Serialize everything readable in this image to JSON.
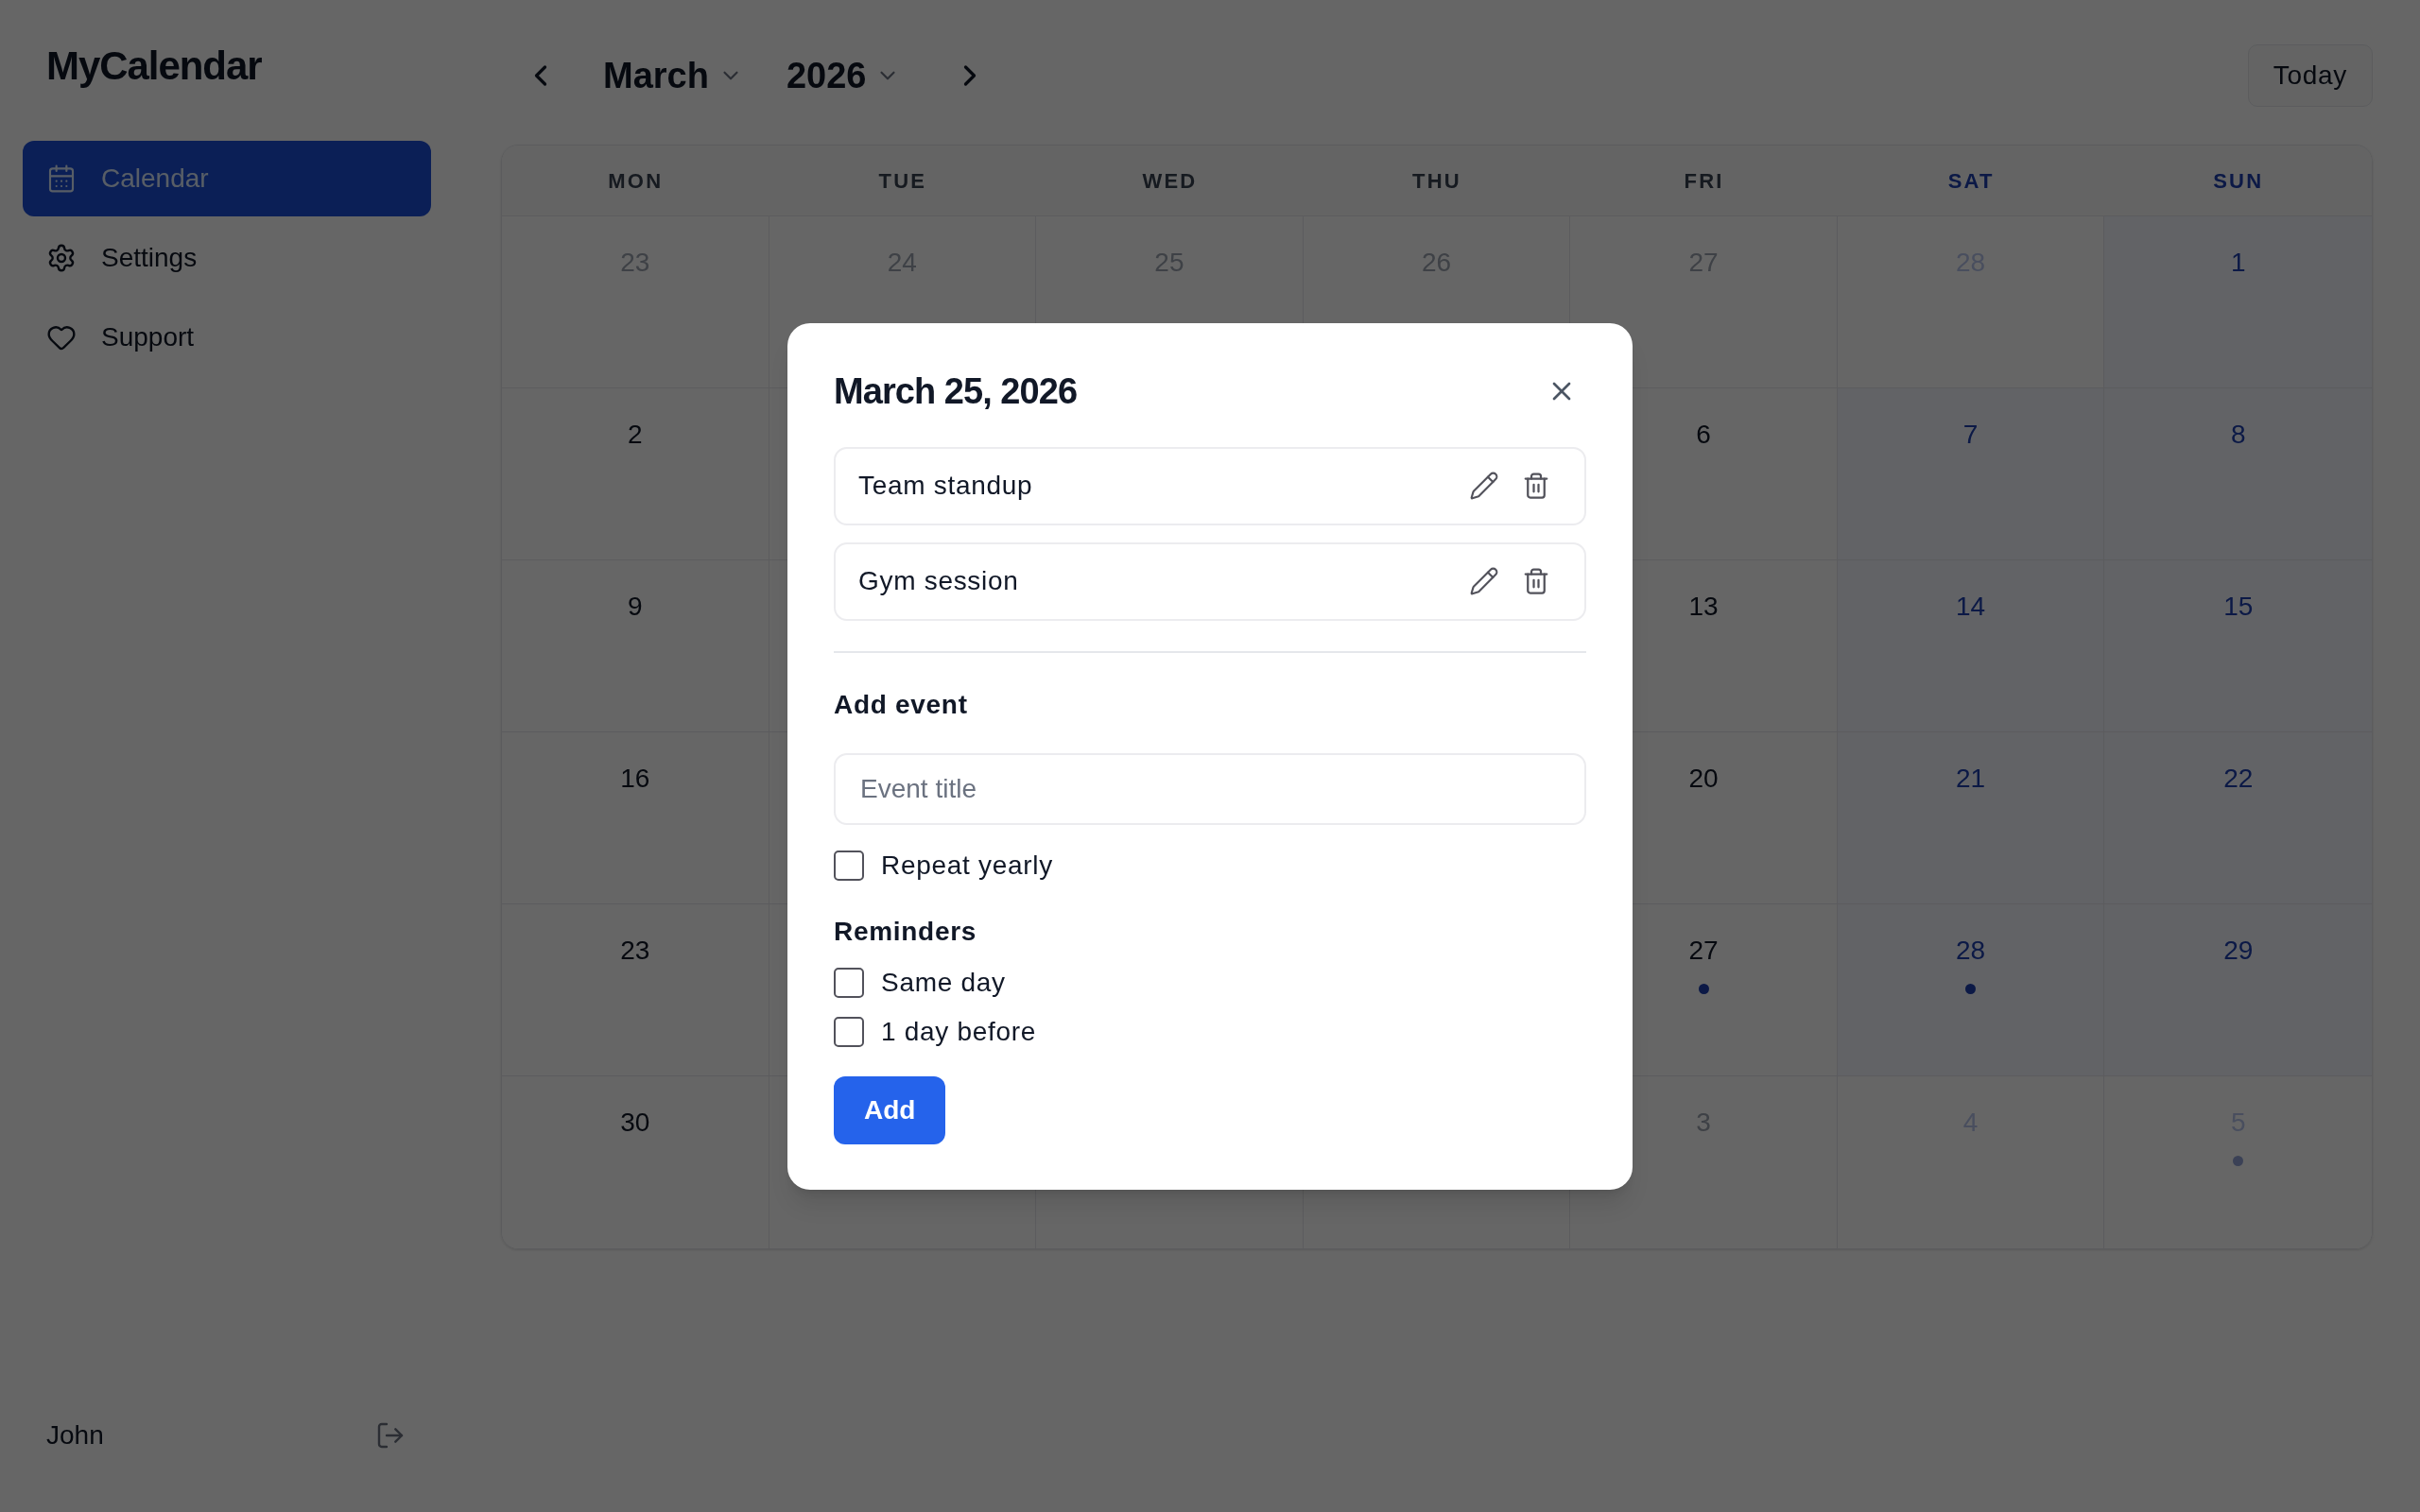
{
  "sidebar": {
    "brand": "MyCalendar",
    "nav": [
      {
        "label": "Calendar",
        "selected": true
      },
      {
        "label": "Settings",
        "selected": false
      },
      {
        "label": "Support",
        "selected": false
      }
    ],
    "user": {
      "name": "John"
    }
  },
  "header": {
    "month": "March",
    "year": "2026",
    "today_button": "Today"
  },
  "calendar": {
    "weekdays": [
      "MON",
      "TUE",
      "WED",
      "THU",
      "FRI",
      "SAT",
      "SUN"
    ],
    "cells": [
      {
        "day": "23",
        "kind": "adjacent"
      },
      {
        "day": "24",
        "kind": "adjacent"
      },
      {
        "day": "25",
        "kind": "adjacent"
      },
      {
        "day": "26",
        "kind": "adjacent"
      },
      {
        "day": "27",
        "kind": "adjacent"
      },
      {
        "day": "28",
        "kind": "adjacent"
      },
      {
        "day": "1",
        "kind": "current"
      },
      {
        "day": "2",
        "kind": "current"
      },
      {},
      {},
      {},
      {
        "day": "6",
        "kind": "current"
      },
      {
        "day": "7",
        "kind": "current"
      },
      {
        "day": "8",
        "kind": "current"
      },
      {
        "day": "9",
        "kind": "current"
      },
      {},
      {},
      {},
      {
        "day": "13",
        "kind": "current"
      },
      {
        "day": "14",
        "kind": "current"
      },
      {
        "day": "15",
        "kind": "current"
      },
      {
        "day": "16",
        "kind": "current"
      },
      {},
      {},
      {},
      {
        "day": "20",
        "kind": "current"
      },
      {
        "day": "21",
        "kind": "current"
      },
      {
        "day": "22",
        "kind": "current"
      },
      {
        "day": "23",
        "kind": "current"
      },
      {},
      {},
      {},
      {
        "day": "27",
        "kind": "current",
        "event": true
      },
      {
        "day": "28",
        "kind": "current",
        "event": true
      },
      {
        "day": "29",
        "kind": "current"
      },
      {
        "day": "30",
        "kind": "current"
      },
      {},
      {},
      {},
      {
        "day": "3",
        "kind": "adjacent"
      },
      {
        "day": "4",
        "kind": "adjacent"
      },
      {
        "day": "5",
        "kind": "adjacent",
        "event": true
      }
    ]
  },
  "dialog": {
    "title": "March 25, 2026",
    "events": [
      {
        "title": "Team standup"
      },
      {
        "title": "Gym session"
      }
    ],
    "add_heading": "Add event",
    "title_field": {
      "placeholder": "Event title"
    },
    "repeat": {
      "label": "Repeat yearly",
      "checked": false
    },
    "reminders_heading": "Reminders",
    "reminders": [
      {
        "label": "Same day",
        "checked": false
      },
      {
        "label": "1 day before",
        "checked": false
      }
    ],
    "add_button": "Add"
  }
}
